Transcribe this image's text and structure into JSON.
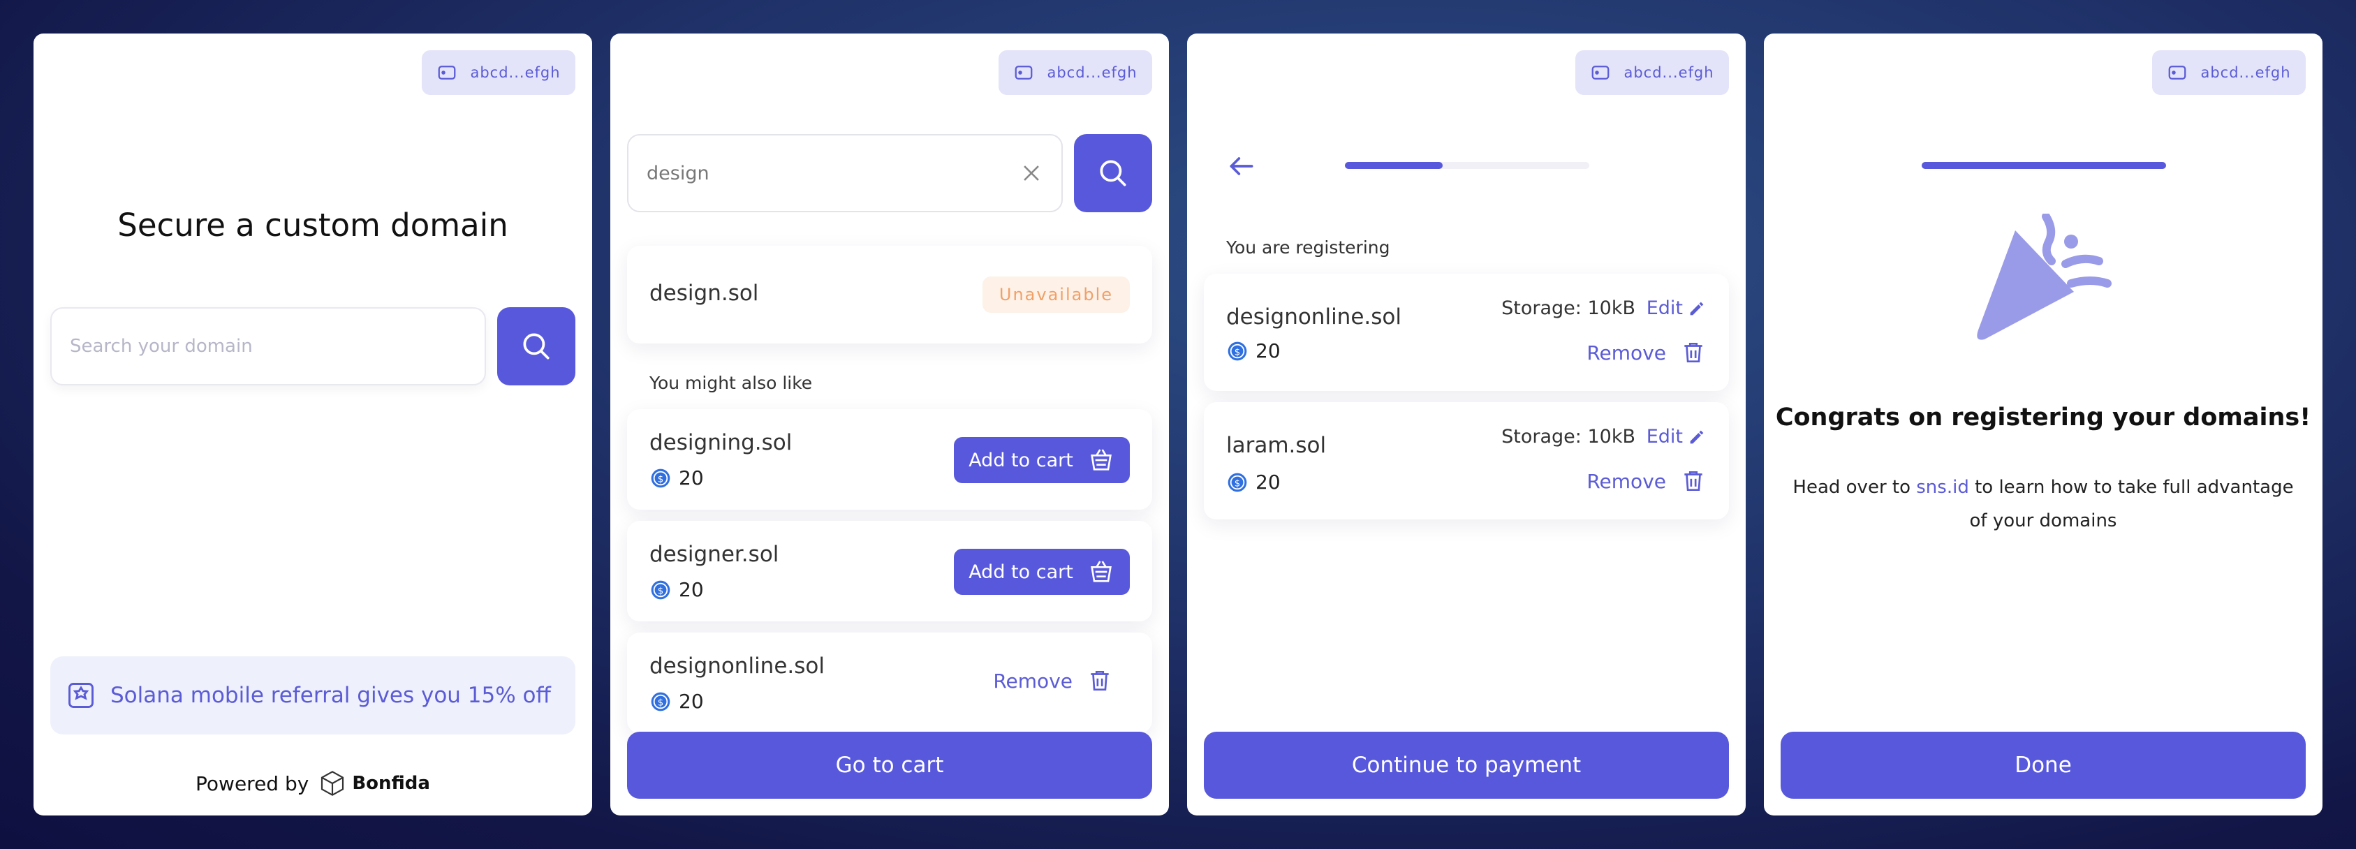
{
  "wallet_address": "abcd...efgh",
  "colors": {
    "accent": "#5858dc",
    "unavailable": "#f0a168"
  },
  "screen1": {
    "title": "Secure a custom domain",
    "search_placeholder": "Search your domain",
    "referral": "Solana mobile referral gives you 15% off",
    "powered_by": "Powered by",
    "brand": "Bonfida"
  },
  "screen2": {
    "query": "design",
    "result": {
      "name": "design.sol",
      "status": "Unavailable"
    },
    "suggestions_title": "You might also like",
    "suggestions": [
      {
        "name": "designing.sol",
        "price": "20",
        "action": "Add to cart"
      },
      {
        "name": "designer.sol",
        "price": "20",
        "action": "Add to cart"
      },
      {
        "name": "designonline.sol",
        "price": "20",
        "action": "Remove"
      }
    ],
    "cta": "Go to cart"
  },
  "screen3": {
    "progress": 0.4,
    "heading": "You are registering",
    "items": [
      {
        "name": "designonline.sol",
        "price": "20",
        "storage": "Storage: 10kB",
        "edit": "Edit",
        "remove": "Remove"
      },
      {
        "name": "laram.sol",
        "price": "20",
        "storage": "Storage: 10kB",
        "edit": "Edit",
        "remove": "Remove"
      }
    ],
    "cta": "Continue to payment"
  },
  "screen4": {
    "progress": 1.0,
    "title": "Congrats on registering your domains!",
    "body_before": "Head over to ",
    "link": "sns.id",
    "body_after": " to learn how to take full advantage of your domains",
    "cta": "Done"
  }
}
